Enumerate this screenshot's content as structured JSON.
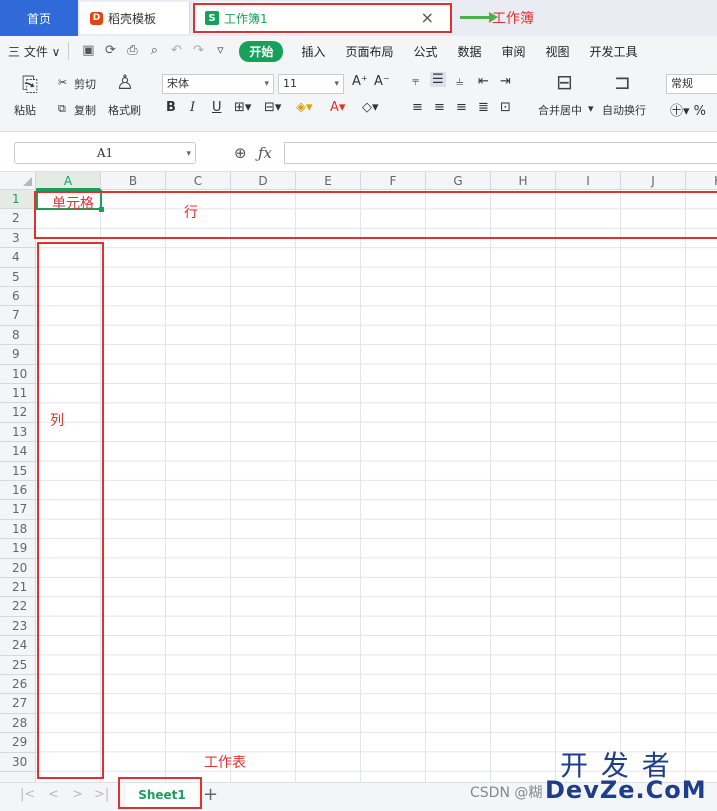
{
  "tabs": {
    "home": "首页",
    "template": "稻壳模板",
    "workbook": "工作簿1",
    "workbook_logo": "S",
    "template_logo": "D"
  },
  "menubar": {
    "file": "三 文件 ∨",
    "items": [
      "开始",
      "插入",
      "页面布局",
      "公式",
      "数据",
      "审阅",
      "视图",
      "开发工具"
    ]
  },
  "ribbon": {
    "cut": "剪切",
    "paste": "粘贴",
    "copy": "复制",
    "format_painter": "格式刷",
    "font": "宋体",
    "size": "11",
    "merge": "合并居中",
    "wrap": "自动换行",
    "number_format": "常规",
    "bold": "B",
    "italic": "I",
    "underline": "U",
    "grow": "A⁺",
    "shrink": "A⁻"
  },
  "formula": {
    "namebox": "A1",
    "fx": "ƒx"
  },
  "grid": {
    "columns": [
      "A",
      "B",
      "C",
      "D",
      "E",
      "F",
      "G",
      "H",
      "I",
      "J",
      "K"
    ],
    "rows": [
      "1",
      "2",
      "3",
      "4",
      "5",
      "6",
      "7",
      "8",
      "9",
      "10",
      "11",
      "12",
      "13",
      "14",
      "15",
      "16",
      "17",
      "18",
      "19",
      "20",
      "21",
      "22",
      "23",
      "24",
      "25",
      "26",
      "27",
      "28",
      "29",
      "30"
    ]
  },
  "sheets": {
    "active": "Sheet1",
    "add": "+"
  },
  "annotations": {
    "workbook": "工作簿",
    "cell": "单元格",
    "row": "行",
    "column": "列",
    "worksheet": "工作表"
  },
  "watermark": {
    "top": "开 发 者",
    "bottom": "DevZe.CoM",
    "csdn": "CSDN @糊"
  },
  "colors": {
    "accent_green": "#18a05a",
    "annotation_red": "#e03131",
    "home_blue": "#2f6ad8"
  }
}
